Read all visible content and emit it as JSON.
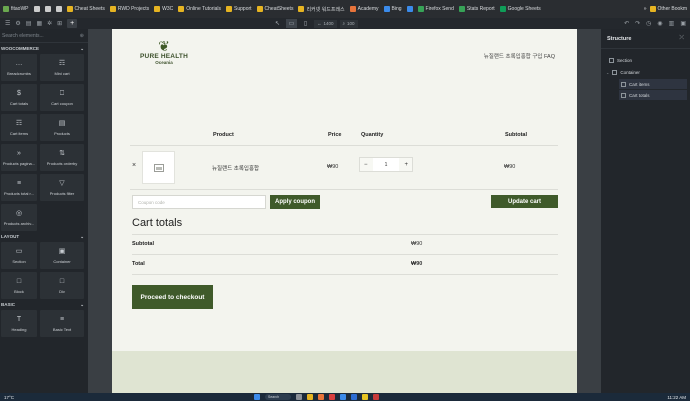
{
  "browser": {
    "bookmarks": [
      {
        "label": "fitaoWP",
        "color": "#6aa84f"
      },
      {
        "label": "",
        "color": "#cccccc"
      },
      {
        "label": "",
        "color": "#cccccc"
      },
      {
        "label": "",
        "color": "#cccccc"
      },
      {
        "label": "Cheat Sheets",
        "color": "#e6b422"
      },
      {
        "label": "RWD Projects",
        "color": "#e6b422"
      },
      {
        "label": "W3C",
        "color": "#e6b422"
      },
      {
        "label": "Online Tutorials",
        "color": "#e6b422"
      },
      {
        "label": "Support",
        "color": "#e6b422"
      },
      {
        "label": "CheatSheets",
        "color": "#e6b422"
      },
      {
        "label": "리커넷 워드프레스",
        "color": "#e6b422"
      },
      {
        "label": "Academy",
        "color": "#e8743b"
      },
      {
        "label": "Bing",
        "color": "#3b8beb"
      },
      {
        "label": "",
        "color": "#3b8beb"
      },
      {
        "label": "Firefox Send",
        "color": "#37a357"
      },
      {
        "label": "Stats Report",
        "color": "#37a357"
      },
      {
        "label": "Google Sheets",
        "color": "#0f9d58"
      }
    ],
    "other_bookmarks": "Other Bookm"
  },
  "toolbar": {
    "width_value": "1400",
    "zoom_value": "100"
  },
  "elements_panel": {
    "search_placeholder": "Search elements...",
    "categories": [
      {
        "name": "WOOCOMMERCE",
        "items": [
          {
            "label": "Breadcrumbs",
            "icon": "…"
          },
          {
            "label": "Mini cart",
            "icon": "☶"
          },
          {
            "label": "Cart totals",
            "icon": "$"
          },
          {
            "label": "Cart coupon",
            "icon": "⎕"
          },
          {
            "label": "Cart items",
            "icon": "☶"
          },
          {
            "label": "Products",
            "icon": "▤"
          },
          {
            "label": "Products pagina...",
            "icon": "»"
          },
          {
            "label": "Products orderby",
            "icon": "⇅"
          },
          {
            "label": "Products total r...",
            "icon": "≡"
          },
          {
            "label": "Products filter",
            "icon": "▽"
          },
          {
            "label": "Products archiv...",
            "icon": "◎"
          }
        ]
      },
      {
        "name": "LAYOUT",
        "items": [
          {
            "label": "Section",
            "icon": "▭"
          },
          {
            "label": "Container",
            "icon": "▣"
          },
          {
            "label": "Block",
            "icon": "□"
          },
          {
            "label": "Div",
            "icon": "□"
          }
        ]
      },
      {
        "name": "BASIC",
        "items": [
          {
            "label": "Heading",
            "icon": "T"
          },
          {
            "label": "Basic Text",
            "icon": "≡"
          }
        ]
      }
    ]
  },
  "site": {
    "logo_line1": "PURE HEALTH",
    "logo_line2": "Oceania",
    "nav_text": "뉴질랜드 초록입홍합 구입 FAQ"
  },
  "cart": {
    "headers": {
      "product": "Product",
      "price": "Price",
      "quantity": "Quantity",
      "subtotal": "Subtotal"
    },
    "item": {
      "remove": "×",
      "name": "뉴질랜드 초록입홍합",
      "price": "₩90",
      "quantity": "1",
      "subtotal": "₩90",
      "minus": "−",
      "plus": "+"
    },
    "coupon_placeholder": "Coupon code",
    "apply_label": "Apply coupon",
    "update_label": "Update cart"
  },
  "totals": {
    "title": "Cart totals",
    "subtotal_label": "Subtotal",
    "subtotal_value": "₩90",
    "total_label": "Total",
    "total_value": "₩90",
    "checkout_label": "Proceed to checkout"
  },
  "structure_panel": {
    "title": "Structure",
    "nodes": [
      {
        "label": "Section"
      },
      {
        "label": "Container"
      },
      {
        "label": "Cart items"
      },
      {
        "label": "Cart totals"
      }
    ]
  },
  "taskbar": {
    "weather": "17°C",
    "search": "Search",
    "time": "11:22 AM"
  },
  "colors": {
    "accent": "#3f5a2a",
    "page_bg": "#f3f4ee",
    "panel_bg": "#22262b"
  }
}
